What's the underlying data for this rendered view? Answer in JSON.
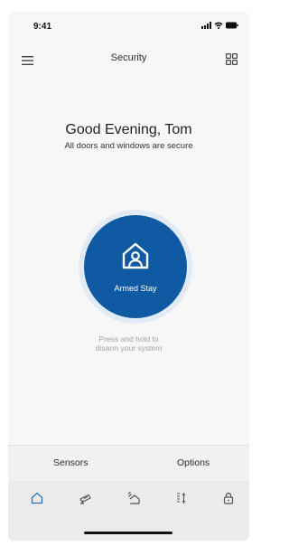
{
  "status_bar": {
    "time": "9:41"
  },
  "header": {
    "title": "Security",
    "menu_icon": "menu-icon",
    "grid_icon": "grid-icon"
  },
  "greeting": {
    "title": "Good Evening, Tom",
    "subtitle": "All doors and windows are secure"
  },
  "arm": {
    "state": "Armed Stay",
    "icon": "house-person-icon",
    "hint_line1": "Press and hold to",
    "hint_line2": "disarm your system",
    "color": "#0f5aa3"
  },
  "options": {
    "sensors": "Sensors",
    "options": "Options"
  },
  "tabs": [
    {
      "icon": "home-icon",
      "active": true
    },
    {
      "icon": "camera-icon",
      "active": false
    },
    {
      "icon": "thermostat-icon",
      "active": false
    },
    {
      "icon": "sort-icon",
      "active": false
    },
    {
      "icon": "lock-icon",
      "active": false
    }
  ],
  "colors": {
    "accent": "#0f5aa3",
    "tab_active": "#2a6fb8",
    "tab_inactive": "#555555"
  }
}
